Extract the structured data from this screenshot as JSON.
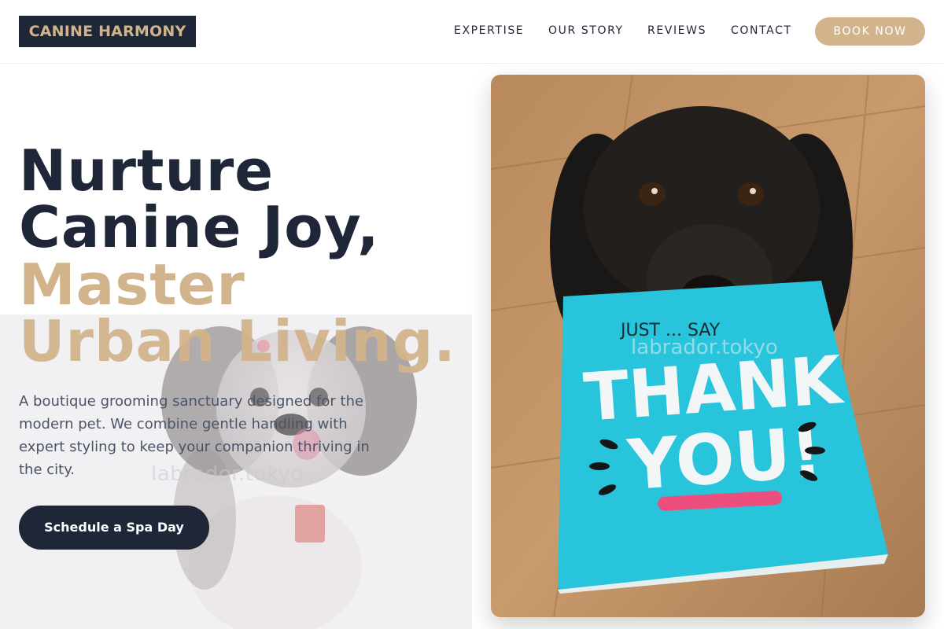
{
  "header": {
    "logo": "CANINE HARMONY",
    "nav": [
      "EXPERTISE",
      "OUR STORY",
      "REVIEWS",
      "CONTACT"
    ],
    "book_label": "BOOK NOW"
  },
  "hero": {
    "line1": "Nurture",
    "line2": "Canine Joy,",
    "line3": "Master",
    "line4": "Urban Living.",
    "description": "A boutique grooming sanctuary designed for the modern pet. We combine gentle handling with expert styling to keep your companion thriving in the city.",
    "cta_label": "Schedule a Spa Day"
  },
  "images": {
    "watermark": "labrador.tokyo",
    "card_top": "JUST ... SAY",
    "card_line1": "THANK",
    "card_line2": "YOU!"
  },
  "colors": {
    "navy": "#1e2638",
    "tan": "#d2b48c",
    "text_gray": "#4a5468"
  }
}
